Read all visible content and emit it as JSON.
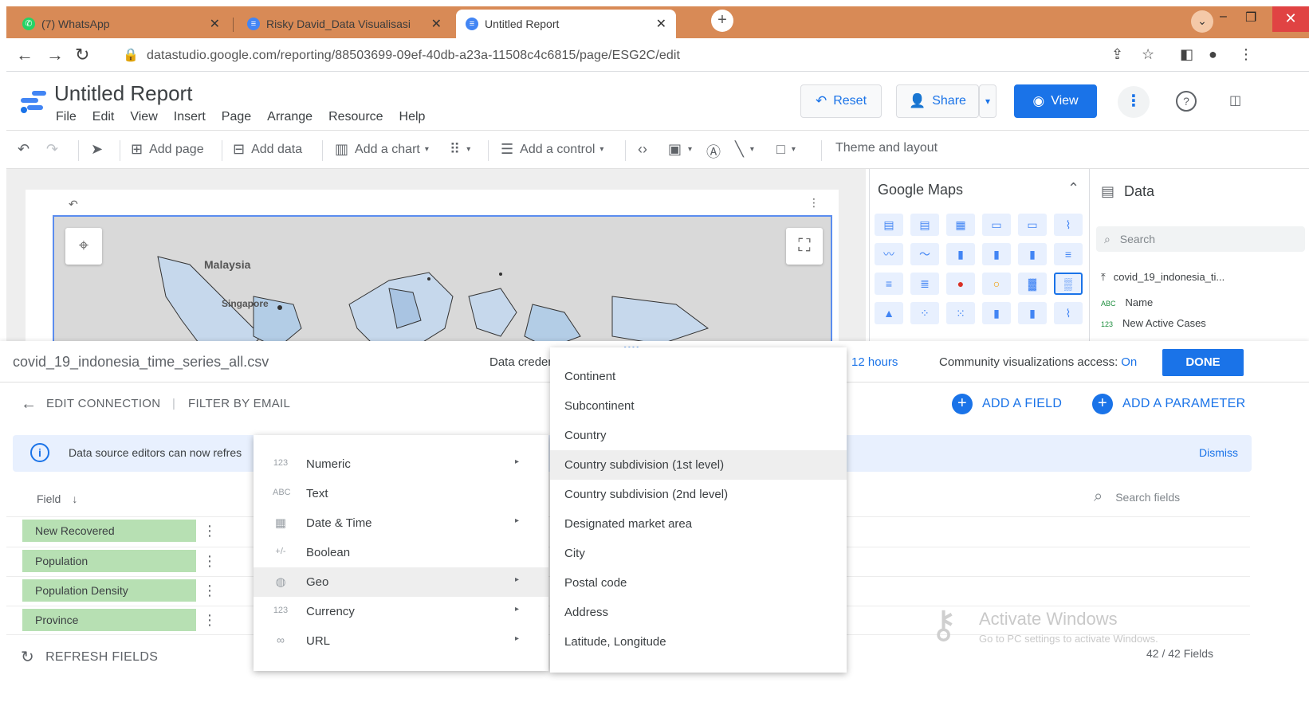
{
  "browser": {
    "tabs": [
      {
        "label": "(7) WhatsApp",
        "icon": "whatsapp-icon"
      },
      {
        "label": "Risky David_Data Visualisasi",
        "icon": "datastudio-icon"
      },
      {
        "label": "Untitled Report",
        "icon": "datastudio-icon"
      }
    ],
    "url": "datastudio.google.com/reporting/88503699-09ef-40db-a23a-11508c4c6815/page/ESG2C/edit"
  },
  "report": {
    "title": "Untitled Report",
    "menu": [
      "File",
      "Edit",
      "View",
      "Insert",
      "Page",
      "Arrange",
      "Resource",
      "Help"
    ],
    "buttons": {
      "reset": "Reset",
      "share": "Share",
      "view": "View"
    }
  },
  "toolbar": {
    "add_page": "Add page",
    "add_data": "Add data",
    "add_chart": "Add a chart",
    "add_control": "Add a control",
    "theme": "Theme and layout"
  },
  "map": {
    "labels": [
      "Malaysia",
      "Singapore"
    ]
  },
  "chart_panel": {
    "title": "Google Maps"
  },
  "data_panel": {
    "title": "Data",
    "search_placeholder": "Search",
    "source": "covid_19_indonesia_ti...",
    "fields": [
      {
        "type": "ABC",
        "name": "Name"
      },
      {
        "type": "123",
        "name": "New Active Cases"
      }
    ]
  },
  "connection": {
    "file": "covid_19_indonesia_time_series_all.csv",
    "credentials": "Data creden",
    "freshness": "12 hours",
    "community": "Community visualizations access:",
    "community_value": "On",
    "done": "DONE",
    "edit": "EDIT CONNECTION",
    "filter": "FILTER BY EMAIL",
    "add_field": "ADD A FIELD",
    "add_parameter": "ADD A PARAMETER"
  },
  "info": {
    "text": "Data source editors can now refres",
    "dismiss": "Dismiss"
  },
  "fields_table": {
    "header": "Field",
    "rows": [
      "New Recovered",
      "Population",
      "Population Density",
      "Province"
    ],
    "refresh": "REFRESH FIELDS",
    "search_placeholder": "Search fields",
    "count": "42 / 42 Fields"
  },
  "type_menu": {
    "items": [
      {
        "label": "Numeric",
        "icon": "123",
        "submenu": true
      },
      {
        "label": "Text",
        "icon": "ABC",
        "submenu": false
      },
      {
        "label": "Date & Time",
        "icon": "calendar-icon",
        "submenu": true
      },
      {
        "label": "Boolean",
        "icon": "boolean-icon",
        "submenu": false
      },
      {
        "label": "Geo",
        "icon": "globe-icon",
        "submenu": true,
        "highlighted": true
      },
      {
        "label": "Currency",
        "icon": "123",
        "submenu": true
      },
      {
        "label": "URL",
        "icon": "link-icon",
        "submenu": true
      }
    ]
  },
  "geo_menu": {
    "items": [
      {
        "label": "Continent"
      },
      {
        "label": "Subcontinent"
      },
      {
        "label": "Country"
      },
      {
        "label": "Country subdivision (1st level)",
        "highlighted": true
      },
      {
        "label": "Country subdivision (2nd level)"
      },
      {
        "label": "Designated market area"
      },
      {
        "label": "City"
      },
      {
        "label": "Postal code"
      },
      {
        "label": "Address"
      },
      {
        "label": "Latitude, Longitude"
      }
    ]
  },
  "watermark": {
    "line1": "Activate Windows",
    "line2": "Go to PC settings to activate Windows."
  },
  "colors": {
    "accent": "#1a73e8",
    "field_chip": "#b7e0b3",
    "tabbar": "#d88a56"
  }
}
